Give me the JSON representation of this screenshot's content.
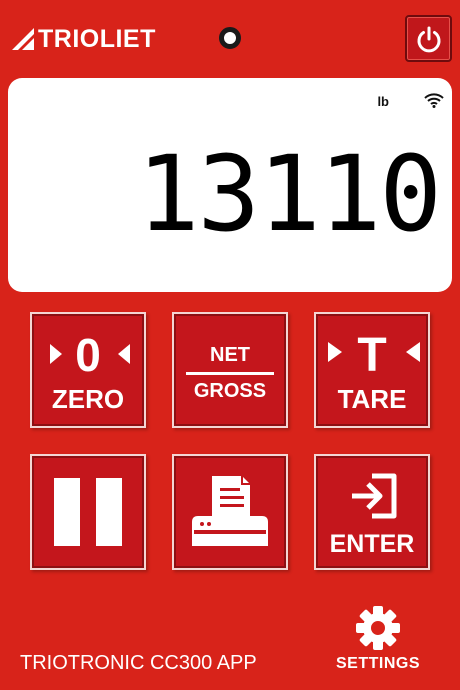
{
  "header": {
    "logo_text": "TRIOLIET",
    "power_icon": "power-icon",
    "indicator_icon": "status-dot-icon"
  },
  "display": {
    "unit": "lb",
    "reading": "13110",
    "wifi_icon": "wifi-icon"
  },
  "keys": {
    "zero": {
      "symbol": "0",
      "label": "ZERO",
      "icon": "zero-arrows-icon"
    },
    "net_gross": {
      "top": "NET",
      "bottom": "GROSS"
    },
    "tare": {
      "symbol": "T",
      "label": "TARE",
      "icon": "tare-arrows-icon"
    },
    "pause": {
      "icon": "pause-icon"
    },
    "print": {
      "icon": "printer-icon"
    },
    "enter": {
      "label": "ENTER",
      "icon": "enter-arrow-icon"
    }
  },
  "footer": {
    "title": "TRIOTRONIC CC300 APP",
    "settings_label": "SETTINGS",
    "settings_icon": "gear-icon"
  },
  "colors": {
    "background": "#d8231a",
    "key": "#c4161c",
    "display": "#ffffff"
  }
}
